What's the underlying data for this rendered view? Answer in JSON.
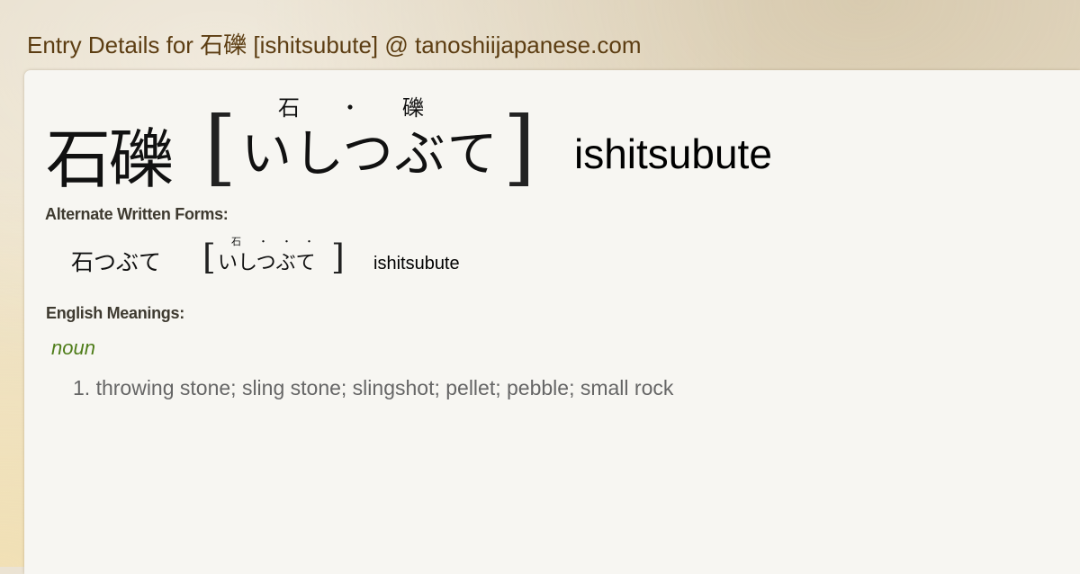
{
  "page": {
    "title": "Entry Details for 石礫 [ishitsubute] @ tanoshiijapanese.com"
  },
  "entry": {
    "kanji": "石礫",
    "reading": "いしつぶて",
    "romaji": "ishitsubute",
    "furigana": [
      "石",
      "・",
      "礫"
    ],
    "bracket_open": "[",
    "bracket_close": "]"
  },
  "alternate_forms": {
    "heading": "Alternate Written Forms:",
    "items": [
      {
        "kanji": "石つぶて",
        "reading": "いしつぶて",
        "romaji": "ishitsubute",
        "furigana": [
          "石",
          "・",
          "・",
          "・"
        ]
      }
    ]
  },
  "meanings": {
    "heading": "English Meanings:",
    "part_of_speech": "noun",
    "items": [
      "1. throwing stone; sling stone; slingshot; pellet; pebble; small rock"
    ]
  },
  "colors": {
    "title": "#5c3d12",
    "part_of_speech": "#4f7d1a",
    "meaning_text": "#666666",
    "card_background": "#f7f6f2"
  }
}
